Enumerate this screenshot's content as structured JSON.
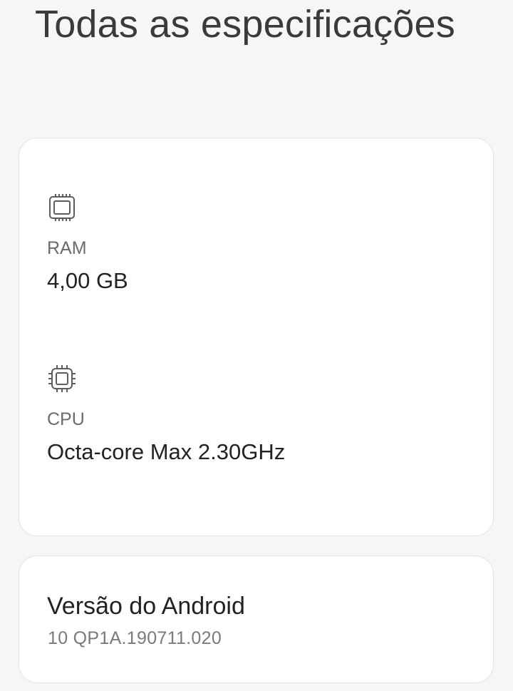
{
  "page": {
    "title": "Todas as especificações"
  },
  "specs": [
    {
      "icon": "memory-chip-icon",
      "label": "RAM",
      "value": "4,00 GB"
    },
    {
      "icon": "processor-icon",
      "label": "CPU",
      "value": "Octa-core Max 2.30GHz"
    }
  ],
  "android": {
    "label": "Versão do Android",
    "value": "10 QP1A.190711.020"
  },
  "colors": {
    "background": "#f6f6f6",
    "card": "#ffffff",
    "primary_text": "#222222",
    "secondary_text": "#6b6b6b"
  }
}
